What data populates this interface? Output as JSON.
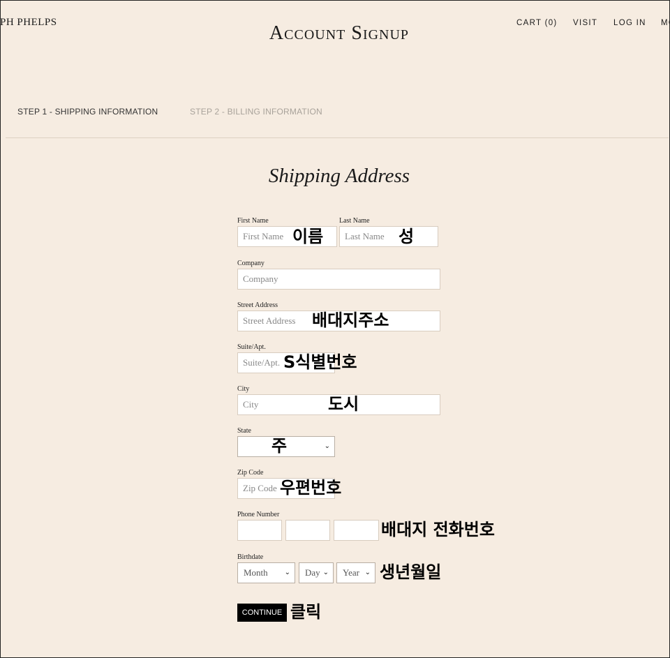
{
  "header": {
    "brand": "PH PHELPS",
    "title": "Account Signup",
    "nav": [
      "CART (0)",
      "VISIT",
      "LOG IN",
      "MO"
    ]
  },
  "steps": {
    "step1": "STEP 1 - SHIPPING INFORMATION",
    "step2": "STEP 2 - BILLING INFORMATION"
  },
  "form": {
    "title": "Shipping Address",
    "first_name": {
      "label": "First Name",
      "placeholder": "First Name",
      "annotation": "이름"
    },
    "last_name": {
      "label": "Last Name",
      "placeholder": "Last Name",
      "annotation": "성"
    },
    "company": {
      "label": "Company",
      "placeholder": "Company"
    },
    "street": {
      "label": "Street Address",
      "placeholder": "Street Address",
      "annotation": "배대지주소"
    },
    "suite": {
      "label": "Suite/Apt.",
      "placeholder": "Suite/Apt.",
      "annotation": "S식별번호"
    },
    "city": {
      "label": "City",
      "placeholder": "City",
      "annotation": "도시"
    },
    "state": {
      "label": "State",
      "annotation": "주"
    },
    "zip": {
      "label": "Zip Code",
      "placeholder": "Zip Code",
      "annotation": "우편번호"
    },
    "phone": {
      "label": "Phone Number",
      "annotation": "배대지 전화번호"
    },
    "birthdate": {
      "label": "Birthdate",
      "month": "Month",
      "day": "Day",
      "year": "Year",
      "annotation": "생년월일"
    },
    "continue_label": "CONTINUE",
    "continue_annotation": "클릭"
  }
}
